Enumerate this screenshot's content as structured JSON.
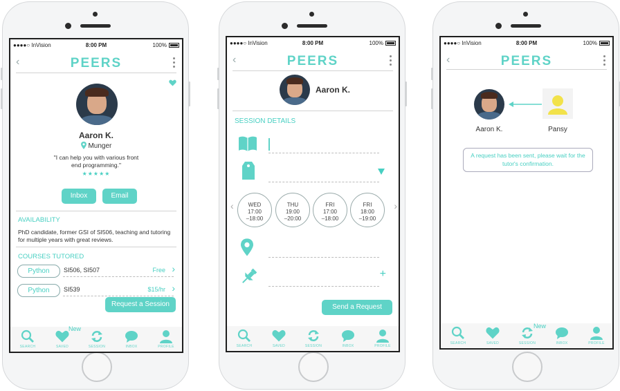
{
  "colors": {
    "accent": "#5fd3c7",
    "accent_dark": "#47cfc2",
    "text": "#333333"
  },
  "status_bar": {
    "carrier": "●●●●○ InVision",
    "time": "8:00 PM",
    "battery": "100%"
  },
  "brand": "PEERS",
  "tab_bar": {
    "items": [
      {
        "label": "SEARCH",
        "icon": "search-icon"
      },
      {
        "label": "SAVED",
        "icon": "heart-icon"
      },
      {
        "label": "SESSION",
        "icon": "refresh-icon"
      },
      {
        "label": "INBOX",
        "icon": "chat-bubble-icon"
      },
      {
        "label": "PROFILE",
        "icon": "person-icon"
      }
    ],
    "new_badge": "New"
  },
  "screen1": {
    "tutor_name": "Aaron K.",
    "location": "Munger",
    "quote": "\"I can help you with various front end programming.\"",
    "rating_stars": "★★★★★",
    "buttons": {
      "inbox": "Inbox",
      "email": "Email"
    },
    "availability_heading": "AVAILABILITY",
    "availability_text": "PhD candidate, former GSI of SI506, teaching and tutoring for multiple years with great reviews.",
    "courses_heading": "COURSES TUTORED",
    "courses": [
      {
        "language": "Python",
        "codes": "SI506, SI507",
        "price": "Free"
      },
      {
        "language": "Python",
        "codes": "SI539",
        "price": "$15/hr"
      }
    ],
    "request_button": "Request a Session"
  },
  "screen2": {
    "tutor_name": "Aaron K.",
    "section_heading": "SESSION DETAILS",
    "time_slots": [
      {
        "day": "WED",
        "start": "17:00",
        "end": "–18:00"
      },
      {
        "day": "THU",
        "start": "19:00",
        "end": "–20:00"
      },
      {
        "day": "FRI",
        "start": "17:00",
        "end": "–18:00"
      },
      {
        "day": "FRI",
        "start": "18:00",
        "end": "–19:00"
      }
    ],
    "add_symbol": "+",
    "send_button": "Send a Request"
  },
  "screen3": {
    "tutor_name": "Aaron K.",
    "student_name": "Pansy",
    "notice": "A request has been sent, please wait for the tutor's confirmation."
  }
}
